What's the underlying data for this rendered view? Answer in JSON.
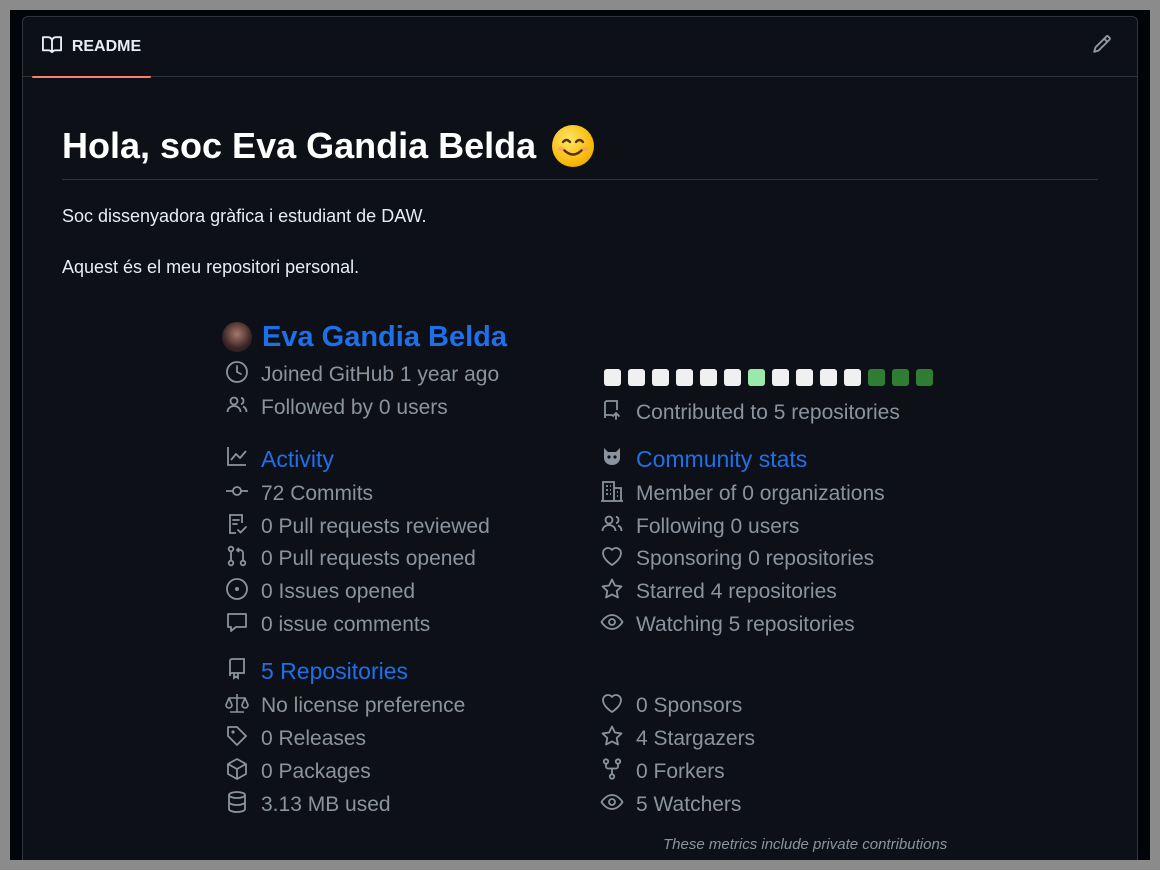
{
  "tab": {
    "label": "README"
  },
  "readme": {
    "title": "Hola, soc Eva Gandia Belda",
    "paragraphs": [
      "Soc dissenyadora gràfica i estudiant de DAW.",
      "Aquest és el meu repositori personal."
    ]
  },
  "metrics": {
    "name": "Eva Gandia Belda",
    "joined": "Joined GitHub 1 year ago",
    "followed_by": "Followed by 0 users",
    "contributed": "Contributed to 5 repositories",
    "calendar_levels": [
      0,
      0,
      0,
      0,
      0,
      0,
      1,
      0,
      0,
      0,
      0,
      2,
      2,
      2
    ],
    "calendar_colors": [
      "#f0f0f0",
      "#9be9a8",
      "#2f7d32"
    ],
    "activity": {
      "heading": "Activity",
      "items": [
        {
          "icon": "commit-icon",
          "text": "72 Commits"
        },
        {
          "icon": "pull-request-reviewed-icon",
          "text": "0 Pull requests reviewed"
        },
        {
          "icon": "pull-request-icon",
          "text": "0 Pull requests opened"
        },
        {
          "icon": "issue-opened-icon",
          "text": "0 Issues opened"
        },
        {
          "icon": "comment-icon",
          "text": "0 issue comments"
        }
      ]
    },
    "community": {
      "heading": "Community stats",
      "items": [
        {
          "icon": "organization-icon",
          "text": "Member of 0 organizations"
        },
        {
          "icon": "people-icon",
          "text": "Following 0 users"
        },
        {
          "icon": "heart-icon",
          "text": "Sponsoring 0 repositories"
        },
        {
          "icon": "star-icon",
          "text": "Starred 4 repositories"
        },
        {
          "icon": "eye-icon",
          "text": "Watching 5 repositories"
        }
      ]
    },
    "repositories": {
      "heading": "5 Repositories",
      "left": [
        {
          "icon": "law-icon",
          "text": "No license preference"
        },
        {
          "icon": "tag-icon",
          "text": "0 Releases"
        },
        {
          "icon": "package-icon",
          "text": "0 Packages"
        },
        {
          "icon": "database-icon",
          "text": "3.13 MB used"
        }
      ],
      "right": [
        {
          "icon": "heart-icon",
          "text": "0 Sponsors"
        },
        {
          "icon": "star-icon",
          "text": "4 Stargazers"
        },
        {
          "icon": "fork-icon",
          "text": "0 Forkers"
        },
        {
          "icon": "eye-icon",
          "text": "5 Watchers"
        }
      ]
    },
    "note": "These metrics include private contributions"
  }
}
